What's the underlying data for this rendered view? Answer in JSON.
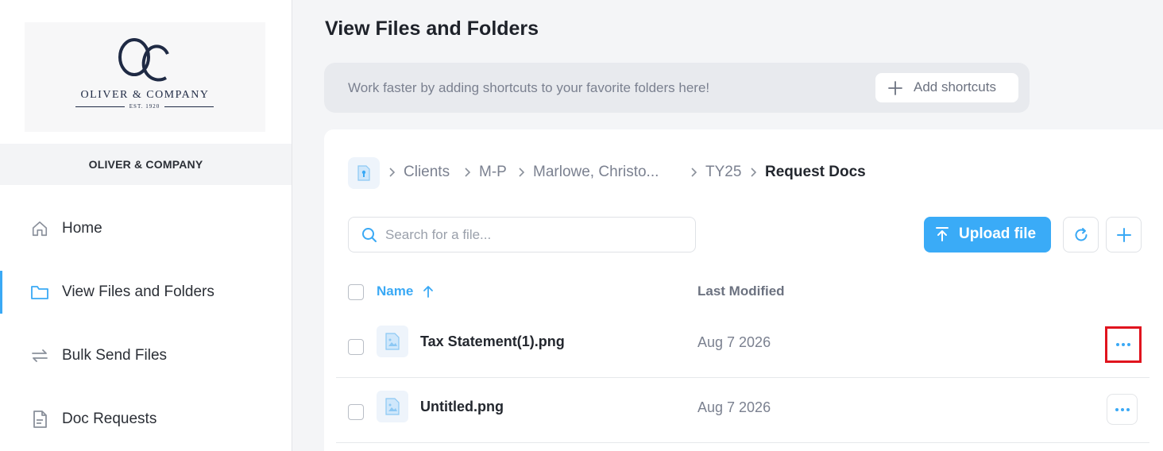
{
  "sidebar": {
    "logo": {
      "monogram": "OC",
      "name": "OLIVER & COMPANY",
      "est": "EST. 1920"
    },
    "company_name": "OLIVER & COMPANY",
    "items": [
      {
        "label": "Home",
        "icon": "home-icon"
      },
      {
        "label": "View Files and Folders",
        "icon": "folder-icon",
        "active": true
      },
      {
        "label": "Bulk Send Files",
        "icon": "transfer-icon"
      },
      {
        "label": "Doc Requests",
        "icon": "document-icon"
      }
    ]
  },
  "main": {
    "title": "View Files and Folders",
    "shortcuts": {
      "text": "Work faster by adding shortcuts to your favorite folders here!",
      "button": "Add shortcuts"
    },
    "breadcrumb": [
      "Clients",
      "M-P",
      "Marlowe, Christo...",
      "TY25",
      "Request Docs"
    ],
    "search": {
      "placeholder": "Search for a file...",
      "value": ""
    },
    "upload_label": "Upload file",
    "columns": {
      "name": "Name",
      "modified": "Last Modified"
    },
    "files": [
      {
        "name": "Tax Statement(1).png",
        "modified": "Aug 7 2026"
      },
      {
        "name": "Untitled.png",
        "modified": "Aug 7 2026"
      }
    ]
  },
  "colors": {
    "accent": "#3aabf7",
    "highlight": "#e0141e"
  }
}
